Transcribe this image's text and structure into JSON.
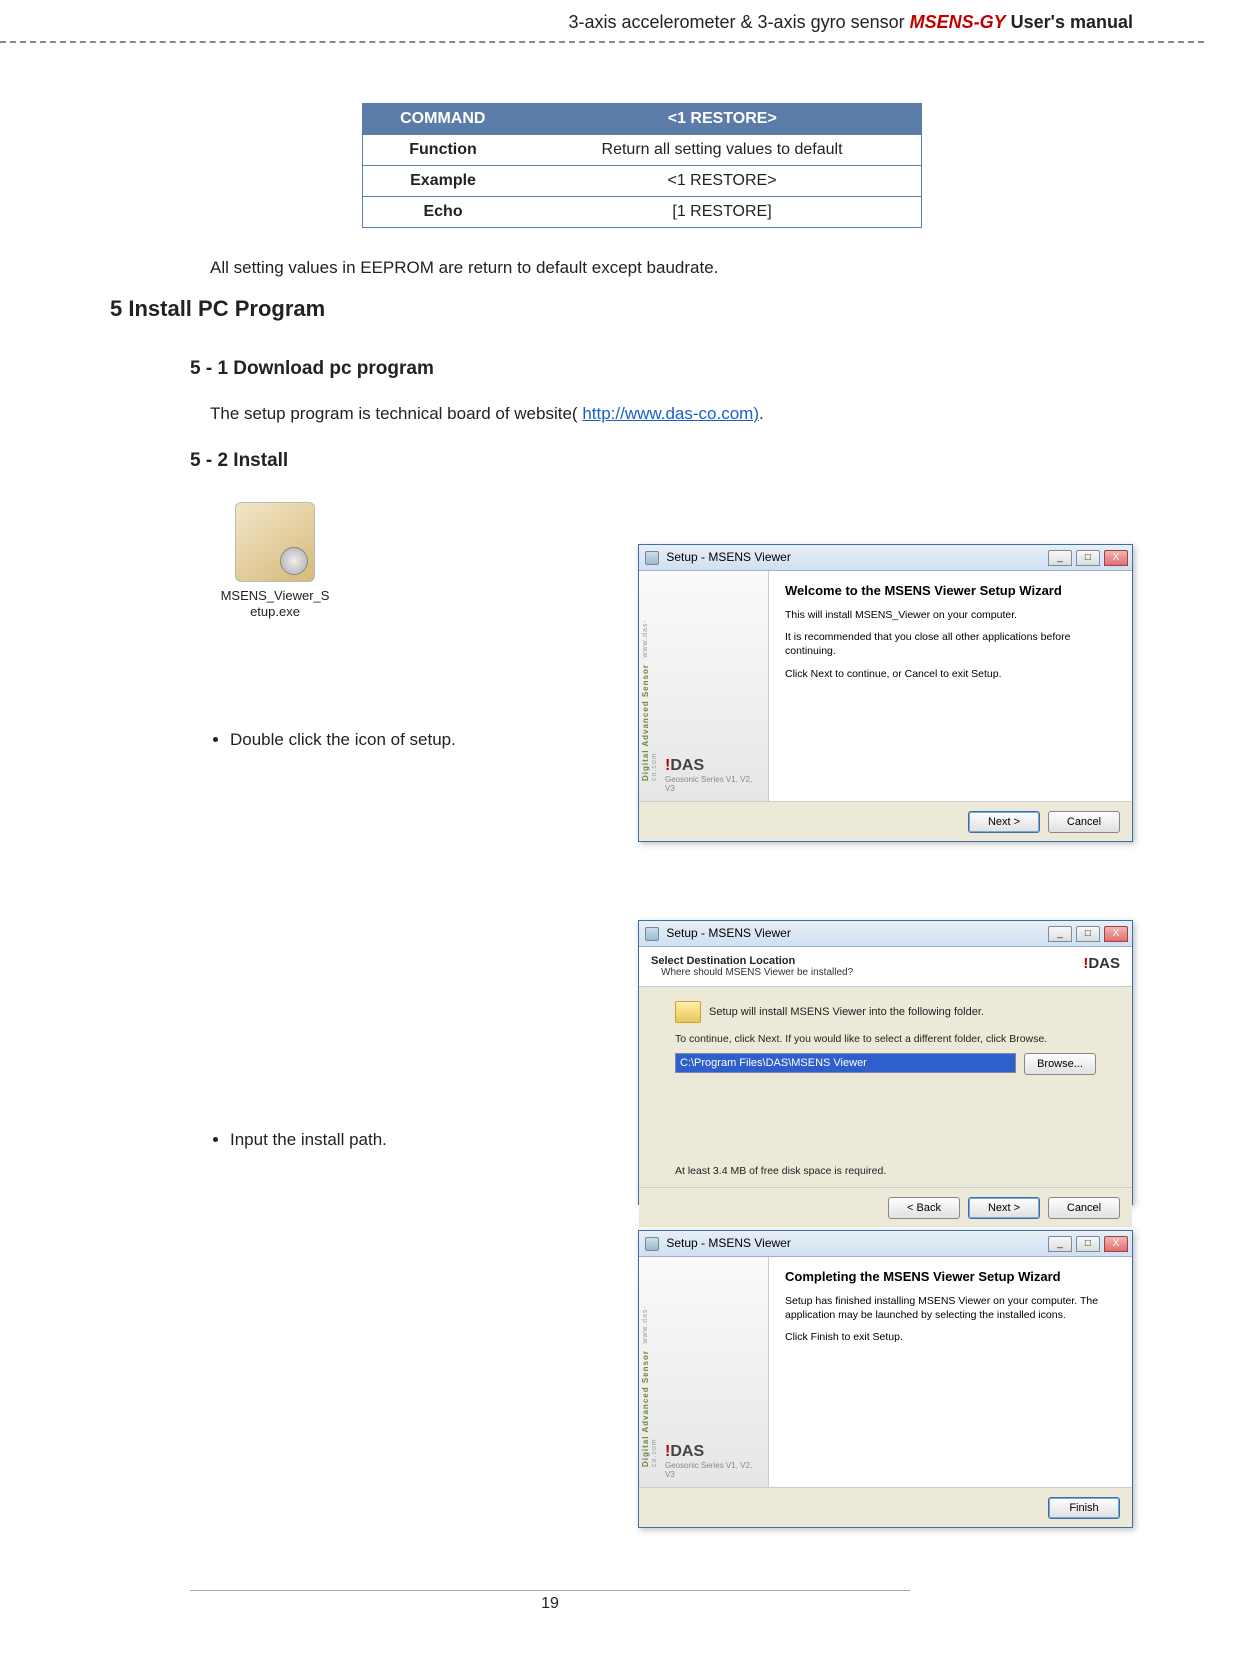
{
  "header": {
    "sensor_desc": "3-axis accelerometer & 3-axis gyro sensor ",
    "model": "MSENS-GY",
    "manual": "  User's manual"
  },
  "command_table": {
    "head_left": "COMMAND",
    "head_right": "<1 RESTORE>",
    "rows": [
      {
        "label": "Function",
        "value": "Return all setting values to default"
      },
      {
        "label": "Example",
        "value": "<1 RESTORE>"
      },
      {
        "label": "Echo",
        "value": "[1 RESTORE]"
      }
    ]
  },
  "note_text": "All setting values in EEPROM are return to default except baudrate.",
  "section5": {
    "title": "5  Install PC Program",
    "sub1": "5 - 1 Download pc program",
    "sub1_body_pre": "The setup program is technical board of website( ",
    "sub1_link": "http://www.das-co.com)",
    "sub1_body_post": ".",
    "sub2": "5 - 2  Install",
    "icon_filename_l1": "MSENS_Viewer_S",
    "icon_filename_l2": "etup.exe",
    "bullet1": "Double click the icon of setup.",
    "bullet2": "Input the install path."
  },
  "wizard1": {
    "titlebar": "Setup - MSENS Viewer",
    "heading": "Welcome to the MSENS Viewer Setup Wizard",
    "p1": "This will install MSENS_Viewer on your computer.",
    "p2": "It is recommended that you close all other applications before continuing.",
    "p3": "Click Next to continue, or Cancel to exit Setup.",
    "sidebar_brand": "Digital Advanced Sensor",
    "sidebar_url": "www.das-co.com",
    "sidebar_logo": "DAS",
    "sidebar_logo_sub": "Geosonic Series V1, V2, V3",
    "next": "Next >",
    "cancel": "Cancel"
  },
  "wizard2": {
    "titlebar": "Setup - MSENS Viewer",
    "hs_title": "Select Destination Location",
    "hs_sub": "Where should MSENS Viewer be installed?",
    "hs_logo": "DAS",
    "folder_text": "Setup will install MSENS Viewer into the following folder.",
    "instr": "To continue, click Next. If you would like to select a different folder, click Browse.",
    "path_value": "C:\\Program Files\\DAS\\MSENS Viewer",
    "browse": "Browse...",
    "req": "At least 3.4 MB of free disk space is required.",
    "back": "< Back",
    "next": "Next >",
    "cancel": "Cancel"
  },
  "wizard3": {
    "titlebar": "Setup - MSENS Viewer",
    "heading": "Completing the MSENS Viewer Setup Wizard",
    "p1": "Setup has finished installing MSENS Viewer on your computer. The application may be launched by selecting the installed icons.",
    "p2": "Click Finish to exit Setup.",
    "finish": "Finish"
  },
  "win_buttons": {
    "min": "_",
    "max": "□",
    "close": "X"
  },
  "page_number": "19"
}
